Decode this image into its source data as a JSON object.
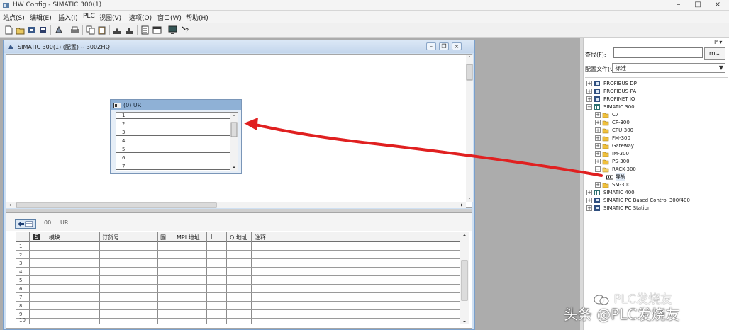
{
  "window": {
    "title": "HW Config - SIMATIC 300(1)",
    "controls": [
      "–",
      "□",
      "×"
    ]
  },
  "menu": [
    "站点(S)",
    "编辑(E)",
    "插入(I)",
    "PLC",
    "视图(V)",
    "选项(O)",
    "窗口(W)",
    "帮助(H)"
  ],
  "station": {
    "title": "SIMATIC 300(1) (配置) -- 300ZHQ",
    "rack_label": "(0) UR",
    "rack_slots": [
      "1",
      "2",
      "3",
      "4",
      "5",
      "6",
      "7"
    ]
  },
  "detail": {
    "nav_a": "00",
    "nav_b": "UR",
    "columns": [
      "S",
      "模块",
      "订货号",
      "固",
      "MPI 地址",
      "I",
      "Q 地址",
      "注释"
    ],
    "rows": [
      "1",
      "2",
      "3",
      "4",
      "5",
      "6",
      "7",
      "8",
      "9",
      "10"
    ]
  },
  "catalog": {
    "profile_button": "P ▾",
    "search_label": "查找(F):",
    "search_value": "",
    "search_button": "m↓",
    "profile_label": "配置文件(O):",
    "profile_value": "标准",
    "tree": [
      {
        "label": "PROFIBUS DP",
        "expander": "+"
      },
      {
        "label": "PROFIBUS-PA",
        "expander": "+"
      },
      {
        "label": "PROFINET IO",
        "expander": "+"
      },
      {
        "label": "SIMATIC 300",
        "expander": "−"
      },
      {
        "label": "C7",
        "expander": "+"
      },
      {
        "label": "CP-300",
        "expander": "+"
      },
      {
        "label": "CPU-300",
        "expander": "+"
      },
      {
        "label": "FM-300",
        "expander": "+"
      },
      {
        "label": "Gateway",
        "expander": "+"
      },
      {
        "label": "IM-300",
        "expander": "+"
      },
      {
        "label": "PS-300",
        "expander": "+"
      },
      {
        "label": "RACK-300",
        "expander": "−"
      },
      {
        "label": "导轨",
        "expander": ""
      },
      {
        "label": "SM-300",
        "expander": "+"
      },
      {
        "label": "SIMATIC 400",
        "expander": "+"
      },
      {
        "label": "SIMATIC PC Based Control 300/400",
        "expander": "+"
      },
      {
        "label": "SIMATIC PC Station",
        "expander": "+"
      }
    ]
  },
  "watermark": {
    "brand": "PLC发烧友",
    "source": "头条 @PLC发烧友"
  },
  "colors": {
    "annotation_arrow": "#e02020"
  }
}
